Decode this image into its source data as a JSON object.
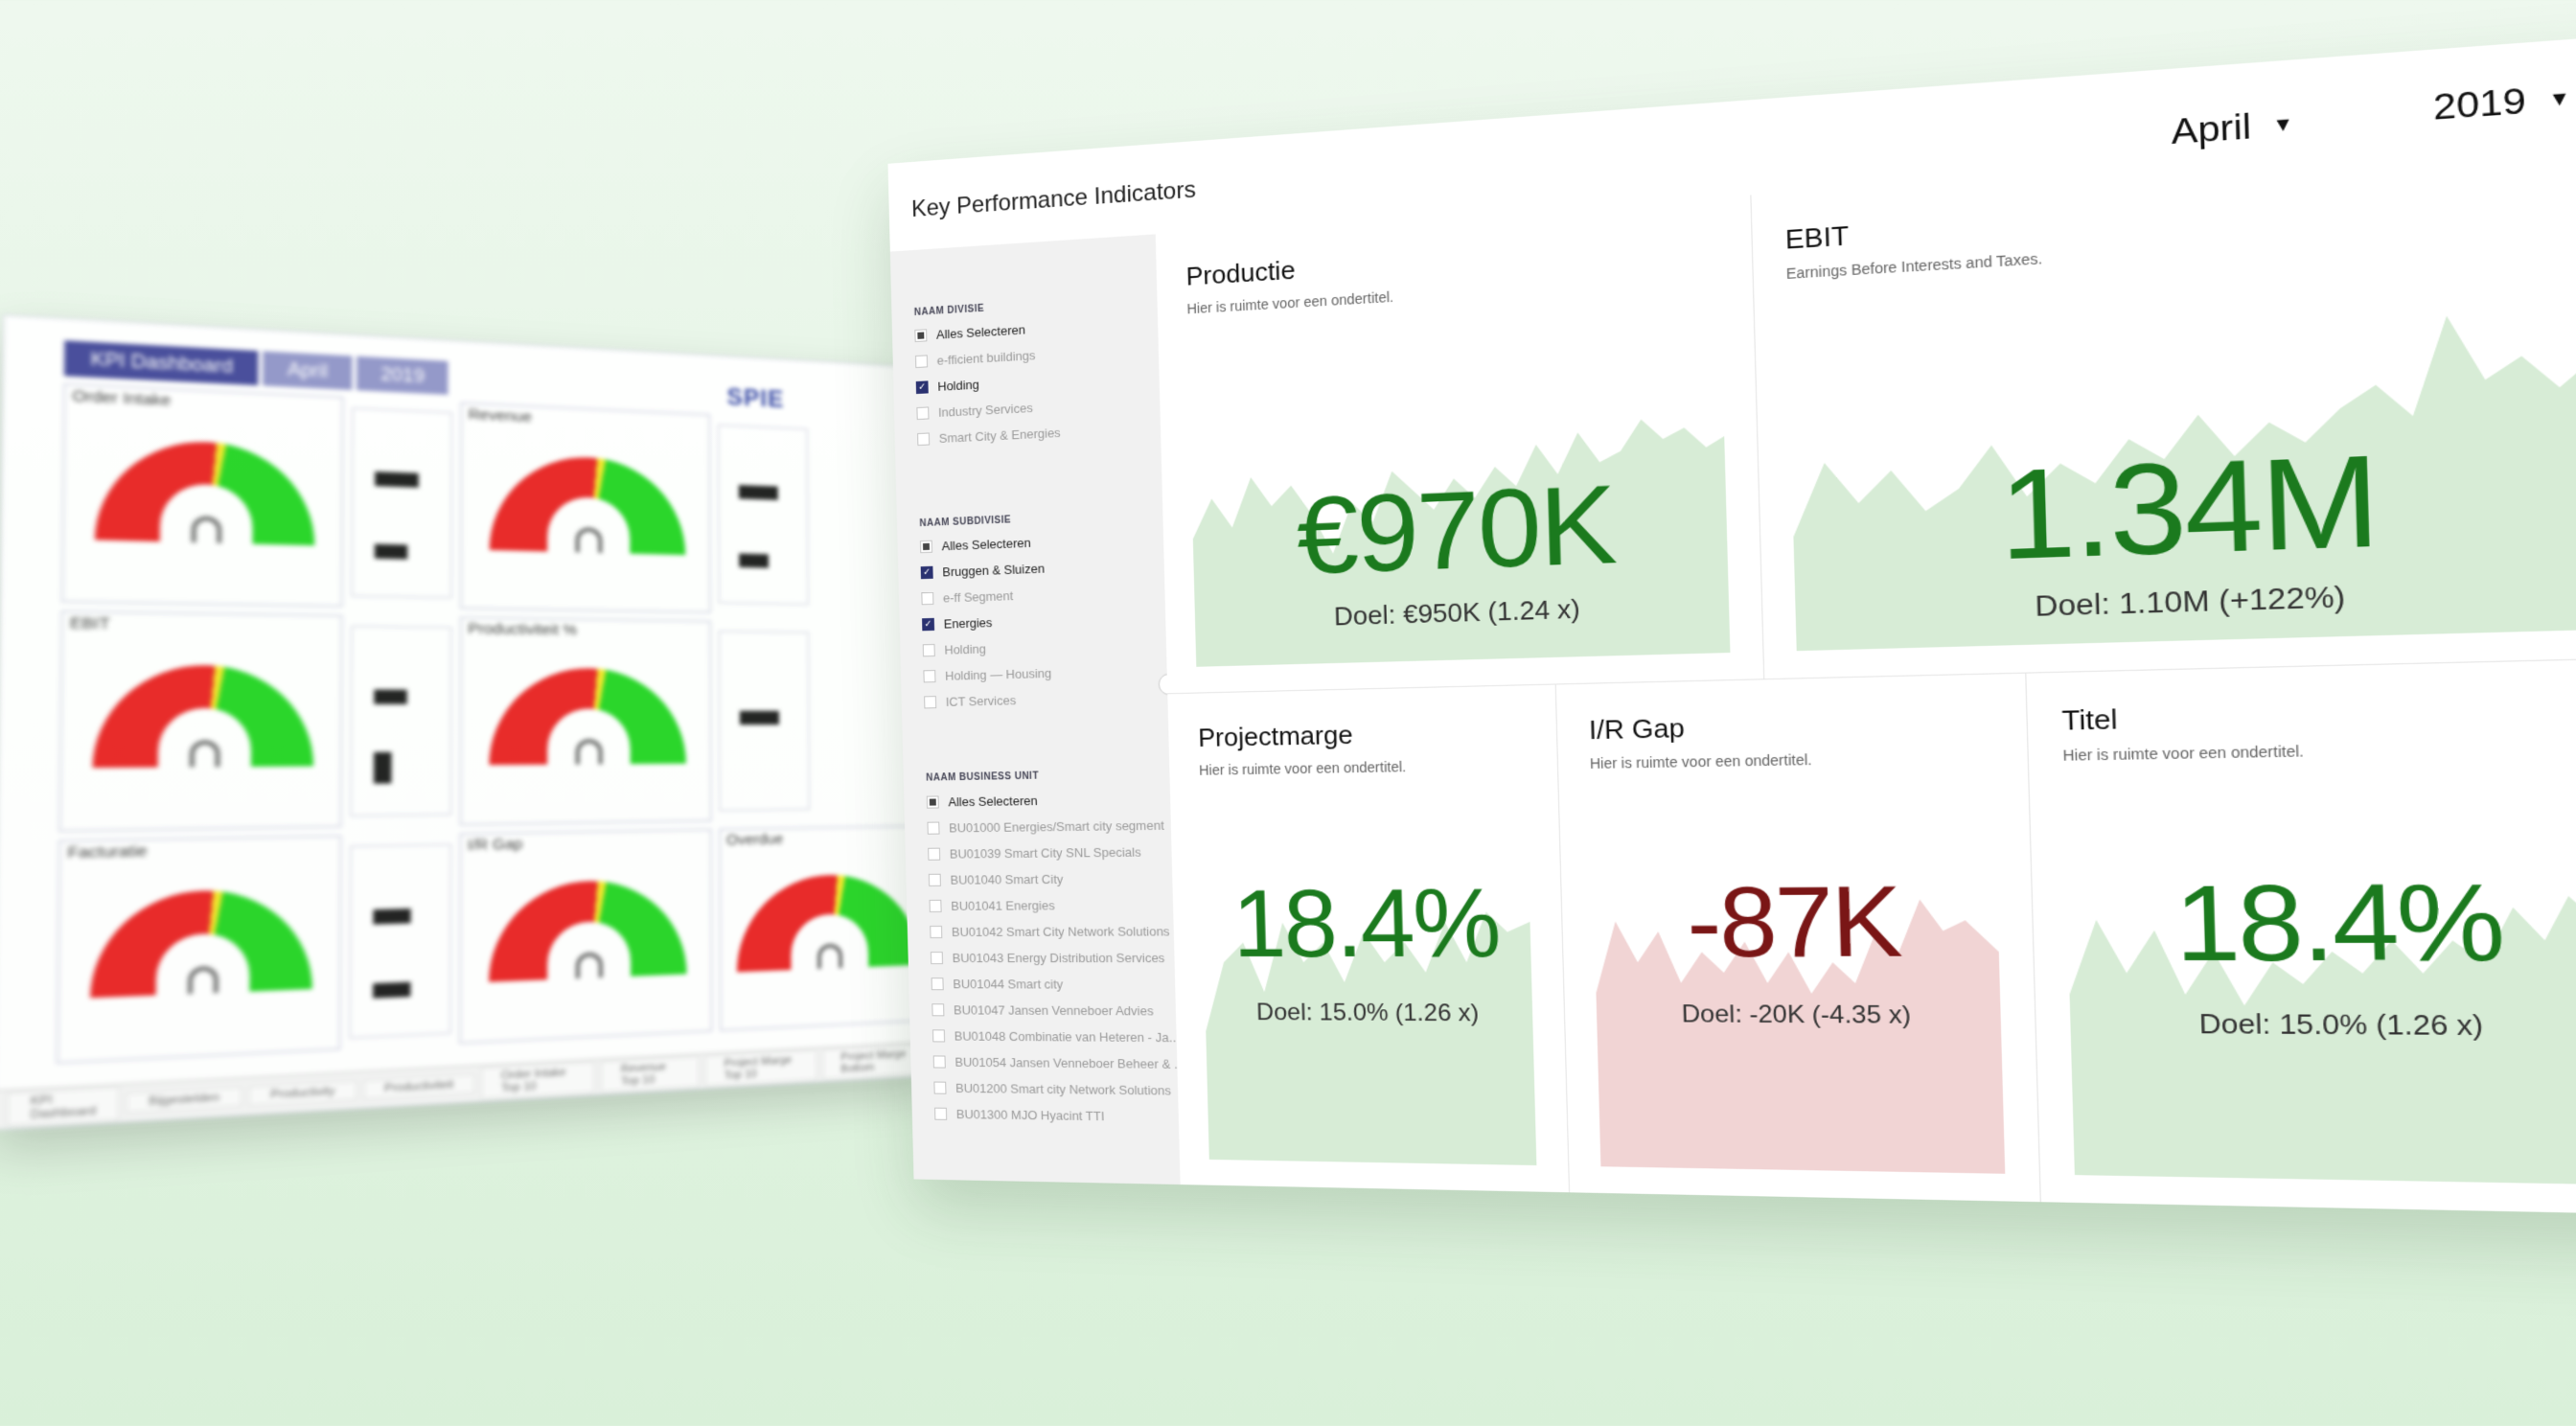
{
  "background_dashboard": {
    "tabs": [
      "KPI Dashboard",
      "April",
      "2019"
    ],
    "logo": "SPIE",
    "cells": [
      "Order Intake",
      "Revenue",
      "EBIT",
      "Productiviteit %",
      "Facturatie",
      "I/R Gap",
      "Overdue"
    ],
    "bottom_tabs": [
      "KPI Dashboard",
      "Bijgestelden",
      "Productivity",
      "Productiviteit",
      "Order Intake Top 10",
      "Revenue Top 10",
      "Project Marge Top 10",
      "Project Marge Bottom"
    ]
  },
  "header": {
    "title": "Key Performance Indicators",
    "month": "April",
    "year": "2019"
  },
  "sidebar": {
    "divisie": {
      "label": "NAAM DIVISIE",
      "items": [
        {
          "label": "Alles Selecteren",
          "state": "partial"
        },
        {
          "label": "e-fficient buildings",
          "state": "off"
        },
        {
          "label": "Holding",
          "state": "checked"
        },
        {
          "label": "Industry Services",
          "state": "off"
        },
        {
          "label": "Smart City & Energies",
          "state": "off"
        }
      ]
    },
    "subdivisie": {
      "label": "NAAM SUBDIVISIE",
      "items": [
        {
          "label": "Alles Selecteren",
          "state": "partial"
        },
        {
          "label": "Bruggen & Sluizen",
          "state": "checked"
        },
        {
          "label": "e-ff Segment",
          "state": "off"
        },
        {
          "label": "Energies",
          "state": "checked"
        },
        {
          "label": "Holding",
          "state": "off"
        },
        {
          "label": "Holding — Housing",
          "state": "off"
        },
        {
          "label": "ICT Services",
          "state": "off"
        }
      ]
    },
    "business_unit": {
      "label": "NAAM BUSINESS UNIT",
      "items": [
        {
          "label": "Alles Selecteren",
          "state": "partial"
        },
        {
          "label": "BU01000 Energies/Smart city segment",
          "state": "off"
        },
        {
          "label": "BU01039 Smart City SNL Specials",
          "state": "off"
        },
        {
          "label": "BU01040 Smart City",
          "state": "off"
        },
        {
          "label": "BU01041 Energies",
          "state": "off"
        },
        {
          "label": "BU01042 Smart City Network Solutions",
          "state": "off"
        },
        {
          "label": "BU01043 Energy Distribution Services",
          "state": "off"
        },
        {
          "label": "BU01044 Smart city",
          "state": "off"
        },
        {
          "label": "BU01047 Jansen Venneboer Advies",
          "state": "off"
        },
        {
          "label": "BU01048 Combinatie van Heteren - Ja...",
          "state": "off"
        },
        {
          "label": "BU01054 Jansen Venneboer Beheer & ...",
          "state": "off"
        },
        {
          "label": "BU01200 Smart city Network Solutions",
          "state": "off"
        },
        {
          "label": "BU01300 MJO Hyacint TTI",
          "state": "off"
        }
      ]
    }
  },
  "cards": [
    {
      "title": "Productie",
      "subtitle": "Hier is ruimte voor een ondertitel.",
      "value": "€970K",
      "goal": "Doel: €950K (1.24 x)",
      "status": "good"
    },
    {
      "title": "EBIT",
      "subtitle": "Earnings Before Interests and Taxes.",
      "value": "1.34M",
      "goal": "Doel: 1.10M (+122%)",
      "status": "good"
    },
    {
      "title": "Projectmarge",
      "subtitle": "Hier is ruimte voor een ondertitel.",
      "value": "18.4%",
      "goal": "Doel: 15.0% (1.26 x)",
      "status": "good"
    },
    {
      "title": "I/R Gap",
      "subtitle": "Hier is ruimte voor een ondertitel.",
      "value": "-87K",
      "goal": "Doel: -20K (-4.35 x)",
      "status": "bad"
    },
    {
      "title": "Titel",
      "subtitle": "Hier is ruimte voor een ondertitel.",
      "value": "18.4%",
      "goal": "Doel: 15.0% (1.26 x)",
      "status": "good"
    }
  ],
  "colors": {
    "good_text": "#1b7a1e",
    "good_fill": "#d7ecd6",
    "bad_text": "#7a1616",
    "bad_fill": "#f1d4d4",
    "checkbox": "#2a3170"
  },
  "icons": [
    "chevron-down-icon",
    "collapse-left-icon",
    "checkbox-icon"
  ]
}
